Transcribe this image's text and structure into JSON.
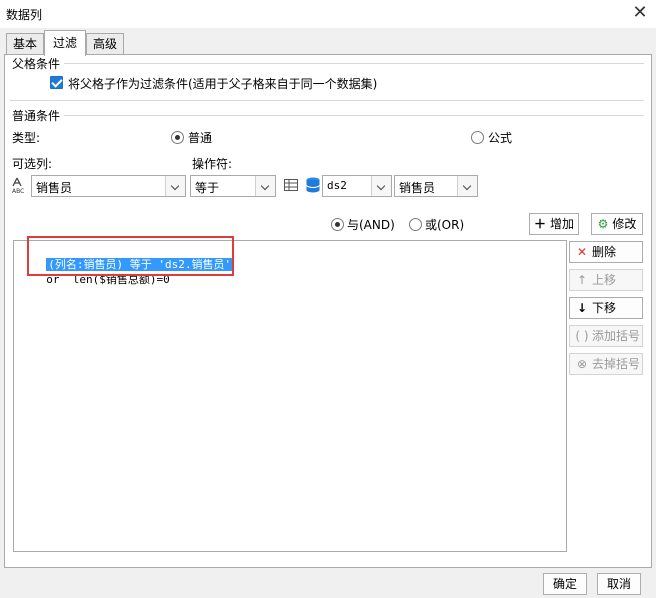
{
  "window": {
    "title": "数据列",
    "close_glyph": "✕"
  },
  "tabs": [
    {
      "label": "基本",
      "active": false
    },
    {
      "label": "过滤",
      "active": true
    },
    {
      "label": "高级",
      "active": false
    }
  ],
  "parent_condition": {
    "section_label": "父格条件",
    "checkbox_label": "将父格子作为过滤条件(适用于父子格来自于同一个数据集)",
    "checked": true
  },
  "normal_condition": {
    "section_label": "普通条件",
    "type_label": "类型:",
    "type_options": [
      {
        "label": "普通",
        "selected": true
      },
      {
        "label": "公式",
        "selected": false
      }
    ],
    "optional_col_label": "可选列:",
    "operator_label": "操作符:",
    "column_value": "销售员",
    "operator_value": "等于",
    "dataset_value": "ds2",
    "field_value": "销售员"
  },
  "logic": {
    "and_label": "与(AND)",
    "or_label": "或(OR)",
    "and_selected": true
  },
  "actions": {
    "add_label": "增加",
    "modify_label": "修改"
  },
  "conditions": [
    {
      "text": "(列名:销售员) 等于 'ds2.销售员'",
      "selected": true
    },
    {
      "text": "or  len($销售总额)=0",
      "selected": false
    }
  ],
  "side_buttons": {
    "delete_label": "删除",
    "up_label": "上移",
    "down_label": "下移",
    "add_bracket_label": "添加括号",
    "remove_bracket_label": "去掉括号"
  },
  "footer": {
    "ok_label": "确定",
    "cancel_label": "取消"
  },
  "colors": {
    "selection": "#3399ff",
    "highlight_box": "#e03c3c",
    "check_blue": "#1e7bd7"
  }
}
